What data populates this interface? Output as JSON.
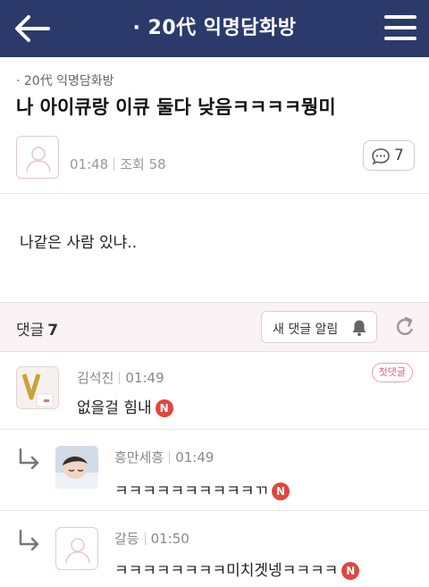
{
  "header": {
    "title": "· 20代 익명담화방",
    "back_icon": "back-arrow-icon",
    "menu_icon": "hamburger-menu-icon",
    "background": "#2b3a6b"
  },
  "post": {
    "board": "· 20代 익명담화방",
    "title": "나 아이큐랑 이큐 둘다 낮음ㅋㅋㅋㅋ뭥미",
    "time": "01:48",
    "views": "조회 58",
    "comment_count": "7",
    "body": "나같은 사람 있냐.."
  },
  "comments_section": {
    "label": "댓글",
    "count": "7",
    "notify_label": "새 댓글 알림"
  },
  "comments": [
    {
      "name": "김석진",
      "time": "01:49",
      "text": "없을걸 힘내",
      "badge": "N",
      "first_label": "첫댓글"
    },
    {
      "name": "흥만세흥",
      "time": "01:49",
      "text": "ㅋㅋㅋㅋㅋㅋㅋㅋㅋㅋㄲ",
      "badge": "N"
    },
    {
      "name": "갈등",
      "time": "01:50",
      "text": "ㅋㅋㅋㅋㅋㅋㅋㅋ미치겟넹ㅋㅋㅋㅋ",
      "badge": "N"
    }
  ]
}
